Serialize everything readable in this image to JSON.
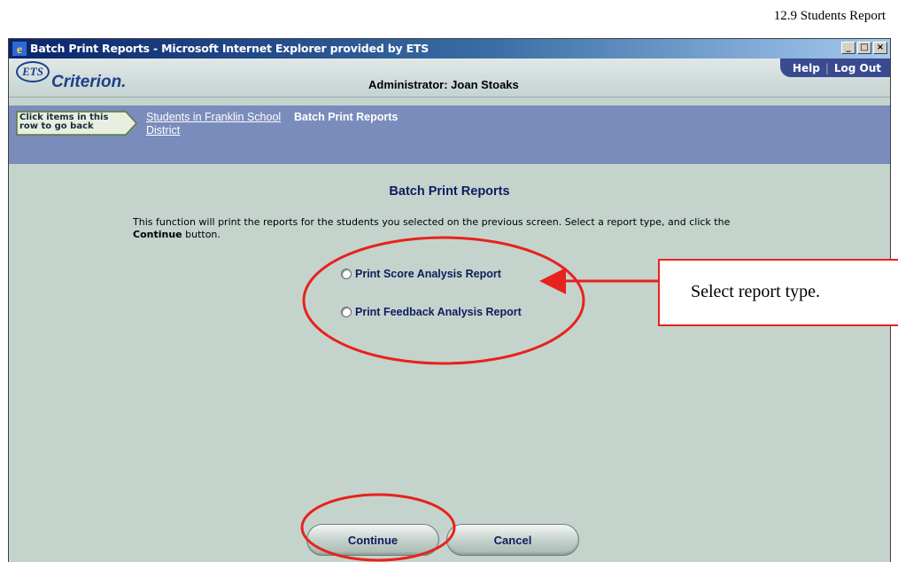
{
  "page_label": "12.9 Students Report",
  "window": {
    "title": "Batch Print Reports - Microsoft Internet Explorer provided by ETS",
    "controls": [
      "_",
      "□",
      "×"
    ]
  },
  "header": {
    "logo_ets": "ETS",
    "logo_name": "Criterion.",
    "admin": "Administrator: Joan Stoaks",
    "help": "Help",
    "logout": "Log Out"
  },
  "breadcrumb": {
    "hint": "Click items in this row to go back",
    "link": "Students in Franklin School District",
    "current": "Batch Print Reports"
  },
  "main": {
    "title": "Batch Print Reports",
    "instructions_before": "This function will print the reports for the students you selected on the previous screen. Select a report type, and click the ",
    "instructions_bold": "Continue",
    "instructions_after": " button.",
    "options": [
      "Print Score Analysis Report",
      "Print Feedback Analysis Report"
    ],
    "continue": "Continue",
    "cancel": "Cancel"
  },
  "callout": {
    "text": "Select report type."
  },
  "colors": {
    "annotation_red": "#e8221d",
    "breadcrumb_bg": "#7a8cbb",
    "content_bg": "#c4d4cd",
    "heading_navy": "#0e1d5c"
  }
}
